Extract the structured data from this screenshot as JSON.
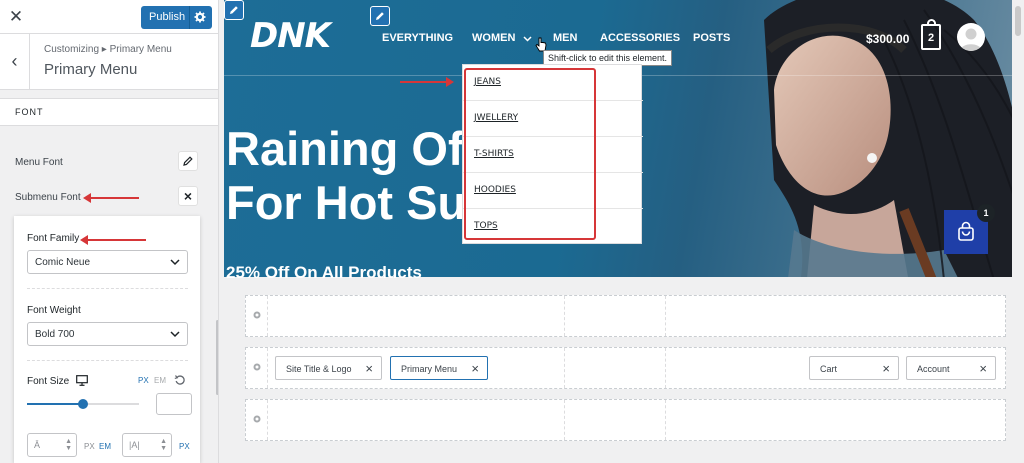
{
  "sidebar": {
    "close_icon": "close-icon",
    "publish_label": "Publish",
    "breadcrumb_parent": "Customizing ▸ Primary Menu",
    "breadcrumb_title": "Primary Menu",
    "section_label": "FONT",
    "menu_font_label": "Menu Font",
    "submenu_font_label": "Submenu Font"
  },
  "font_popup": {
    "family_label": "Font Family",
    "family_value": "Comic Neue",
    "weight_label": "Font Weight",
    "weight_value": "Bold 700",
    "size_label": "Font Size",
    "unit_px": "PX",
    "unit_em": "EM",
    "size_value": "",
    "slider_value": 0.5,
    "line_height_unit_px": "PX",
    "line_height_unit_em": "EM",
    "letter_spacing_unit_px": "PX"
  },
  "preview": {
    "logo": "DNK",
    "nav": [
      "EVERYTHING",
      "WOMEN",
      "MEN",
      "ACCESSORIES",
      "POSTS"
    ],
    "cart_total": "$300.00",
    "cart_count": "2",
    "tooltip": "Shift-click to edit this element.",
    "submenu": [
      "JEANS",
      "JWELLERY",
      "T-SHIRTS",
      "HOODIES",
      "TOPS"
    ],
    "hero_line1": "Raining Of",
    "hero_line2": "For Hot Su",
    "hero_sub": "25% Off On All Products",
    "float_cart_badge": "1"
  },
  "builder": {
    "row2_chips": [
      "Site Title & Logo",
      "Primary Menu",
      "Cart",
      "Account"
    ]
  },
  "colors": {
    "accent": "#2271b1",
    "highlight": "#d63638",
    "hero_blue": "#1d6d97",
    "float_cart": "#1f3fa8"
  }
}
